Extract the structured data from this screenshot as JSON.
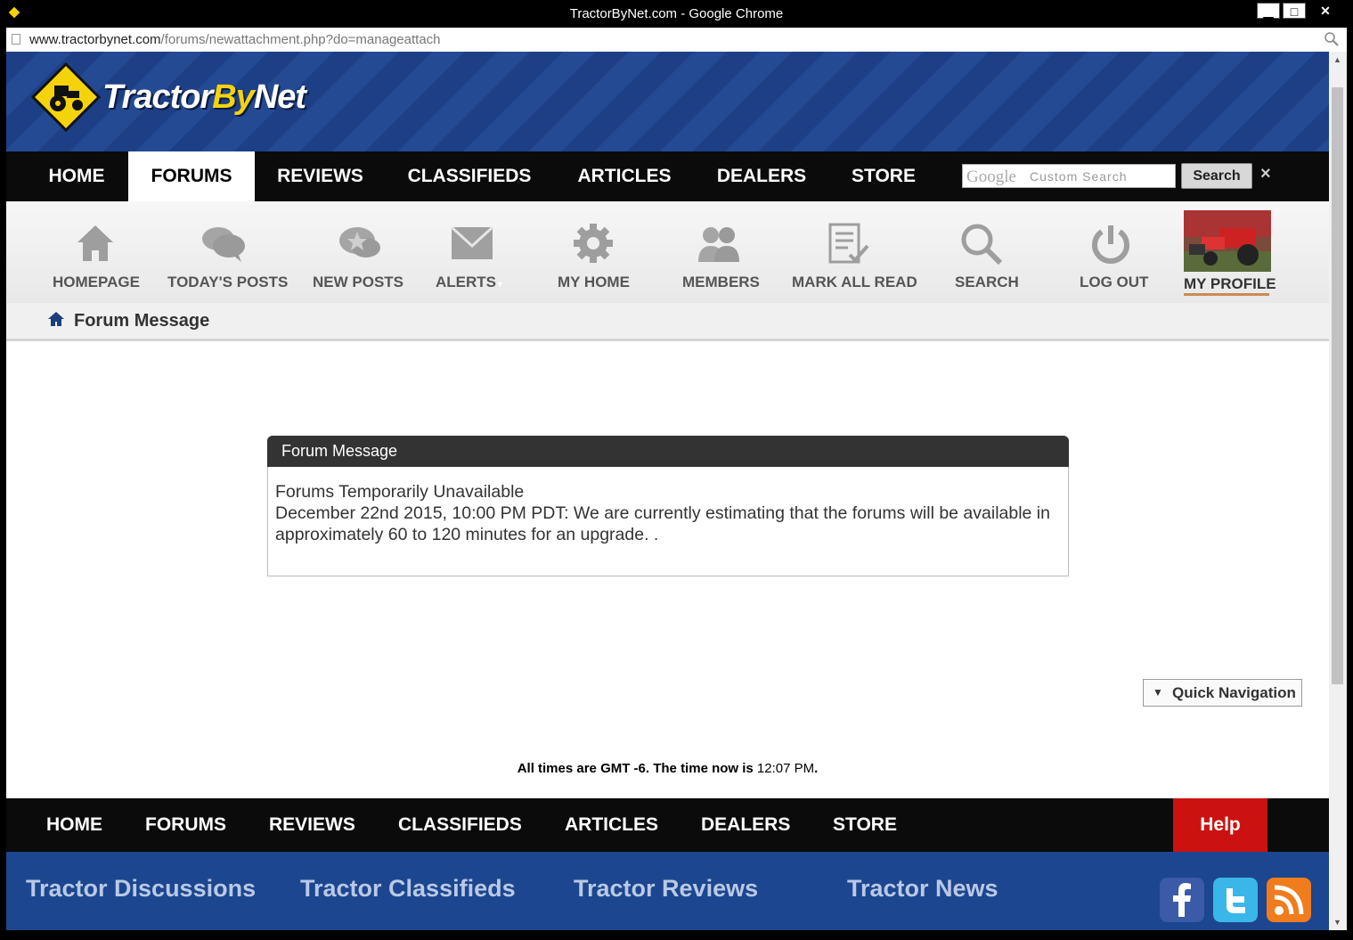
{
  "window": {
    "title": "TractorByNet.com - Google Chrome",
    "minimize": "▁",
    "maximize": "□",
    "close": "✕"
  },
  "browser": {
    "url_host": "www.tractorbynet.com",
    "url_path": "/forums/newattachment.php?do=manageattach"
  },
  "site": {
    "logo_text_a": "Tractor",
    "logo_text_b": "By",
    "logo_text_c": "Net",
    "top_nav": [
      "HOME",
      "FORUMS",
      "REVIEWS",
      "CLASSIFIEDS",
      "ARTICLES",
      "DEALERS",
      "STORE"
    ],
    "active_nav": "FORUMS",
    "search": {
      "google_text": "Google",
      "placeholder": "Custom Search",
      "button": "Search",
      "close": "×"
    }
  },
  "toolbar": {
    "items": [
      "HOMEPAGE",
      "TODAY'S POSTS",
      "NEW POSTS",
      "ALERTS",
      "MY HOME",
      "MEMBERS",
      "MARK ALL READ",
      "SEARCH",
      "LOG OUT",
      "MY PROFILE"
    ]
  },
  "breadcrumb": {
    "label": "Forum Message"
  },
  "message": {
    "header": "Forum Message",
    "line1": "Forums Temporarily Unavailable",
    "line2": "December 22nd 2015, 10:00 PM PDT: We are currently estimating that the forums will be available in approximately 60 to 120 minutes for an upgrade. ."
  },
  "quick_nav": "Quick Navigation",
  "time_info": {
    "prefix": "All times are GMT -6. The time now is",
    "time": "12:07 PM",
    "suffix": "."
  },
  "footer": {
    "nav": [
      "HOME",
      "FORUMS",
      "REVIEWS",
      "CLASSIFIEDS",
      "ARTICLES",
      "DEALERS",
      "STORE"
    ],
    "help": "Help",
    "links": [
      "Tractor Discussions",
      "Tractor Classifieds",
      "Tractor Reviews",
      "Tractor News"
    ],
    "social_icons": [
      "facebook-icon",
      "twitter-icon",
      "rss-icon"
    ]
  },
  "colors": {
    "brand_blue": "#1c468f",
    "logo_yellow": "#f5d30a",
    "help_red": "#cc1111",
    "nav_black": "#0b0b0b"
  }
}
